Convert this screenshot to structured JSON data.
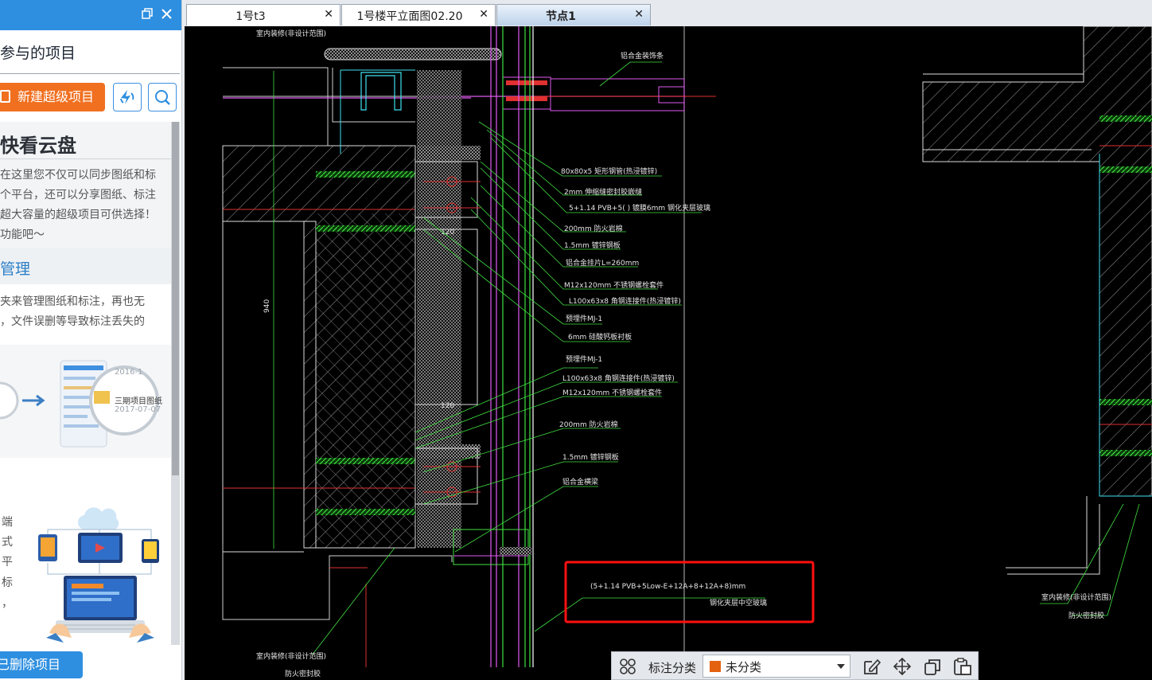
{
  "left_panel": {
    "window_controls": [
      "restore-icon",
      "close-icon"
    ],
    "title": "参与的项目",
    "new_button_label": "新建超级项目",
    "sync_icon": "sync-icon",
    "search_icon": "search-icon",
    "promo": {
      "title": "快看云盘",
      "lines": [
        "在这里您不仅可以同步图纸和标",
        "个平台，还可以分享图纸、标注",
        "超大容量的超级项目可供选择！",
        "功能吧～"
      ],
      "section_title": "管理",
      "section_lines": [
        "夹来管理图纸和标注，再也无",
        "，文件误删等导致标注丢失的"
      ],
      "illustration1": {
        "date1": "2016-1",
        "project": "三期项目图纸",
        "date2": "2017-07-07"
      },
      "side_chars": [
        "端",
        "式",
        "平",
        "标",
        "，"
      ]
    },
    "deleted_button_label": "已删除项目"
  },
  "tabs": [
    {
      "label": "1号t3",
      "active": false
    },
    {
      "label": "1号楼平立面图02.20",
      "active": false
    },
    {
      "label": "节点1",
      "active": true
    }
  ],
  "drawing": {
    "labels": {
      "top_left": "室内装修(非设计范围)",
      "top_right": "铝合金装饰条",
      "a1": "80x80x5    矩形钢管(热浸镀锌)",
      "a2": "2mm    伸缩缝密封胶嵌缝",
      "a3": "5+1.14 PVB+5(       )  镀膜6mm  钢化夹层玻璃",
      "a4": "200mm    防火岩棉",
      "a5": "1.5mm    镀锌钢板",
      "a6": "铝合金挂片L=260mm",
      "a7": "M12x120mm     不锈钢螺栓套件",
      "a8": "L100x63x8      角钢连接件(热浸镀锌)",
      "a9": "预埋件MJ-1",
      "a10": "6mm    硅酸钙板衬板",
      "b1": "预埋件MJ-1",
      "b2": "L100x63x8      角钢连接件(热浸镀锌)",
      "b3": "M12x120mm      不锈钢螺栓套件",
      "b4": "200mm     防火岩棉",
      "b5": "1.5mm     镀锌钢板",
      "b6": "铝合金横梁",
      "highlight1": "(5+1.14 PVB+5Low-E+12A+8+12A+8)mm",
      "highlight2": "钢化夹层中空玻璃",
      "bottom_left1": "室内装修(非设计范围)",
      "bottom_left2": "防火密封胶",
      "right1": "室内装修(非设计范围)",
      "right2": "防火密封胶",
      "dim_940": "940",
      "dim_120a": "120",
      "dim_120b": "120"
    }
  },
  "bottom_toolbar": {
    "grid_icon": "grid-icon",
    "category_label": "标注分类",
    "category_value": "未分类",
    "category_color": "#e4610f",
    "icons": [
      "edit-icon",
      "move-icon",
      "copy-icon",
      "paste-icon"
    ]
  }
}
